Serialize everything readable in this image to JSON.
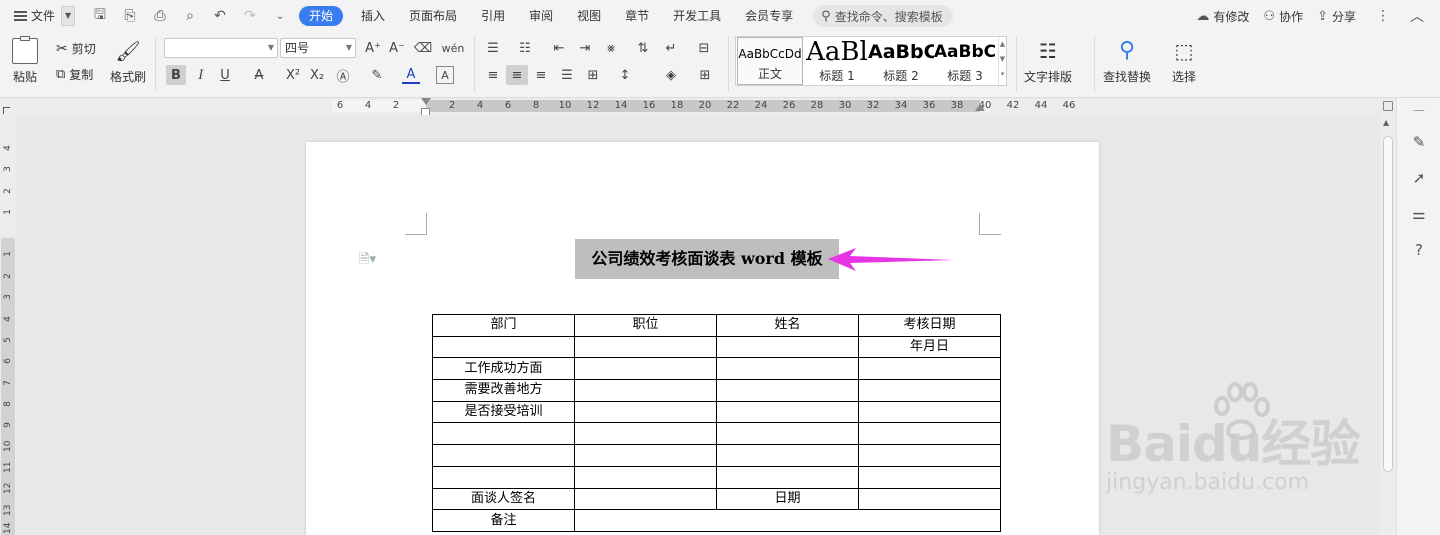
{
  "menubar": {
    "file_label": "文件",
    "tabs": [
      {
        "label": "开始",
        "active": true
      },
      {
        "label": "插入"
      },
      {
        "label": "页面布局"
      },
      {
        "label": "引用"
      },
      {
        "label": "审阅"
      },
      {
        "label": "视图"
      },
      {
        "label": "章节"
      },
      {
        "label": "开发工具"
      },
      {
        "label": "会员专享"
      }
    ],
    "search_placeholder": "查找命令、搜索模板",
    "right": {
      "modified_label": "有修改",
      "collab_label": "协作",
      "share_label": "分享"
    },
    "accent_color": "#3a7bf0"
  },
  "ribbon": {
    "paste_label": "粘贴",
    "cut_label": "剪切",
    "copy_label": "复制",
    "format_painter_label": "格式刷",
    "font_name_value": "",
    "font_size_value": "四号",
    "styles": [
      {
        "preview": "AaBbCcDd",
        "name": "正文",
        "selected": true
      },
      {
        "preview": "AaBl",
        "name": "标题 1"
      },
      {
        "preview": "AaBbC",
        "name": "标题 2"
      },
      {
        "preview": "AaBbC",
        "name": "标题 3"
      }
    ],
    "text_layout_label": "文字排版",
    "find_replace_label": "查找替换",
    "select_label": "选择"
  },
  "ruler": {
    "h_ticks": [
      "6",
      "4",
      "2",
      "2",
      "4",
      "6",
      "8",
      "10",
      "12",
      "14",
      "16",
      "18",
      "20",
      "22",
      "24",
      "26",
      "28",
      "30",
      "32",
      "34",
      "36",
      "38",
      "40",
      "42",
      "44",
      "46"
    ],
    "v_ticks": [
      "4",
      "3",
      "2",
      "1",
      "1",
      "2",
      "3",
      "4",
      "5",
      "6",
      "7",
      "8",
      "9",
      "10",
      "11",
      "12",
      "13",
      "14"
    ]
  },
  "document": {
    "title": "公司绩效考核面谈表 word 模板",
    "title_highlight_color": "#bebebe",
    "arrow_color": "#e535e5",
    "table": {
      "rows": [
        [
          "部门",
          "职位",
          "姓名",
          "考核日期"
        ],
        [
          "",
          "",
          "",
          "年月日"
        ],
        [
          "工作成功方面",
          "",
          "",
          ""
        ],
        [
          "需要改善地方",
          "",
          "",
          ""
        ],
        [
          "是否接受培训",
          "",
          "",
          ""
        ],
        [
          "",
          "",
          "",
          ""
        ],
        [
          "",
          "",
          "",
          ""
        ],
        [
          "",
          "",
          "",
          ""
        ],
        [
          "面谈人签名",
          "",
          "日期",
          ""
        ],
        [
          "备注",
          ""
        ]
      ]
    }
  },
  "watermark": {
    "main": "Baidu经验",
    "sub": "jingyan.baidu.com"
  }
}
